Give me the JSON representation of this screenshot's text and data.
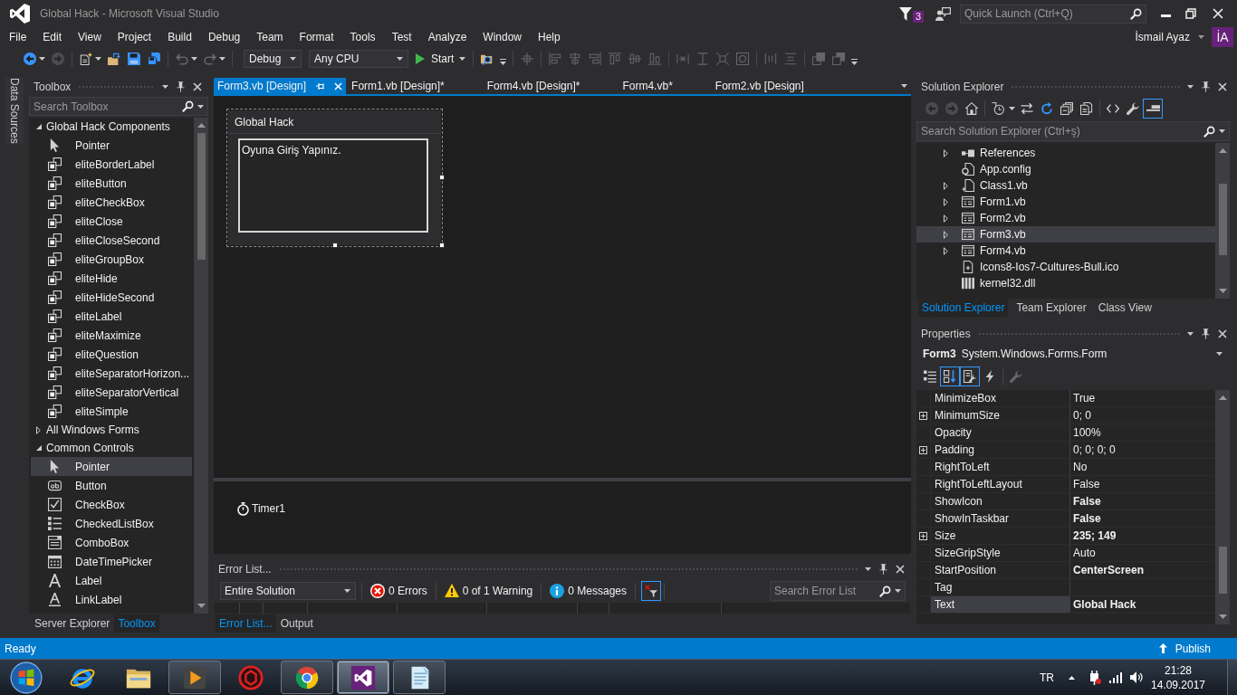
{
  "window": {
    "title": "Global Hack - Microsoft Visual Studio",
    "notification_count": "3",
    "quick_launch": {
      "placeholder": "Quick Launch (Ctrl+Q)"
    },
    "account": {
      "name": "İsmail Ayaz",
      "initials": "İA"
    }
  },
  "menu": [
    "File",
    "Edit",
    "View",
    "Project",
    "Build",
    "Debug",
    "Team",
    "Format",
    "Tools",
    "Test",
    "Analyze",
    "Window",
    "Help"
  ],
  "toolbar": {
    "groups": [
      {
        "items": [
          {
            "kind": "back",
            "disabled": false,
            "dropdown": true
          },
          {
            "kind": "forward",
            "disabled": true,
            "dropdown": false
          }
        ]
      },
      {
        "items": [
          {
            "kind": "new-project",
            "disabled": false,
            "dropdown": true
          },
          {
            "kind": "open",
            "disabled": false,
            "dropdown": false
          },
          {
            "kind": "save",
            "disabled": false,
            "dropdown": false
          },
          {
            "kind": "save-all",
            "disabled": false,
            "dropdown": false
          }
        ]
      },
      {
        "items": [
          {
            "kind": "undo",
            "disabled": true,
            "dropdown": true
          },
          {
            "kind": "redo",
            "disabled": true,
            "dropdown": true
          }
        ]
      },
      {
        "items": [
          {
            "kind": "configuration",
            "value": "Debug"
          },
          {
            "kind": "platform",
            "value": "Any CPU"
          },
          {
            "kind": "start",
            "label": "Start",
            "dropdown": true
          }
        ]
      },
      {
        "items": [
          {
            "kind": "find",
            "disabled": false,
            "dropdown": false
          },
          {
            "kind": "overflow"
          }
        ]
      },
      {
        "items": [
          {
            "kind": "align-grid",
            "disabled": true,
            "dropdown": false
          }
        ]
      },
      {
        "items": [
          {
            "kind": "align-left",
            "disabled": true,
            "dropdown": false
          },
          {
            "kind": "align-center",
            "disabled": true,
            "dropdown": false
          },
          {
            "kind": "align-right",
            "disabled": true,
            "dropdown": false
          },
          {
            "kind": "align-top",
            "disabled": true,
            "dropdown": false
          },
          {
            "kind": "align-middle",
            "disabled": true,
            "dropdown": false
          },
          {
            "kind": "align-bottom",
            "disabled": true,
            "dropdown": false
          }
        ]
      },
      {
        "items": [
          {
            "kind": "same-width",
            "disabled": true,
            "dropdown": false
          },
          {
            "kind": "same-height",
            "disabled": true,
            "dropdown": false
          },
          {
            "kind": "same-size",
            "disabled": true,
            "dropdown": false
          },
          {
            "kind": "size-grid",
            "disabled": true,
            "dropdown": false
          }
        ]
      },
      {
        "items": [
          {
            "kind": "horizontal-spacing",
            "disabled": true,
            "dropdown": false
          },
          {
            "kind": "vertical-spacing",
            "disabled": true,
            "dropdown": false
          }
        ]
      },
      {
        "items": [
          {
            "kind": "bring-front",
            "disabled": true,
            "dropdown": false
          },
          {
            "kind": "send-back",
            "disabled": true,
            "dropdown": false
          },
          {
            "kind": "overflow"
          }
        ]
      }
    ]
  },
  "side_tabs": [
    {
      "label": "Data Sources"
    }
  ],
  "toolbox": {
    "title": "Toolbox",
    "search": {
      "placeholder": "Search Toolbox"
    },
    "groups": [
      {
        "label": "Global Hack Components",
        "expanded": true,
        "children": [
          {
            "label": "Pointer",
            "kind": "pointer",
            "selected": false
          },
          {
            "label": "eliteBorderLabel",
            "kind": "component",
            "selected": false
          },
          {
            "label": "eliteButton",
            "kind": "component",
            "selected": false
          },
          {
            "label": "eliteCheckBox",
            "kind": "component",
            "selected": false
          },
          {
            "label": "eliteClose",
            "kind": "component",
            "selected": false
          },
          {
            "label": "eliteCloseSecond",
            "kind": "component",
            "selected": false
          },
          {
            "label": "eliteGroupBox",
            "kind": "component",
            "selected": false
          },
          {
            "label": "eliteHide",
            "kind": "component",
            "selected": false
          },
          {
            "label": "eliteHideSecond",
            "kind": "component",
            "selected": false
          },
          {
            "label": "eliteLabel",
            "kind": "component",
            "selected": false
          },
          {
            "label": "eliteMaximize",
            "kind": "component",
            "selected": false
          },
          {
            "label": "eliteQuestion",
            "kind": "component",
            "selected": false
          },
          {
            "label": "eliteSeparatorHorizon...",
            "kind": "component",
            "selected": false
          },
          {
            "label": "eliteSeparatorVertical",
            "kind": "component",
            "selected": false
          },
          {
            "label": "eliteSimple",
            "kind": "component",
            "selected": false
          }
        ]
      },
      {
        "label": "All Windows Forms",
        "expanded": false
      },
      {
        "label": "Common Controls",
        "expanded": true,
        "children": [
          {
            "label": "Pointer",
            "kind": "pointer",
            "selected": true
          },
          {
            "label": "Button",
            "kind": "button",
            "selected": false
          },
          {
            "label": "CheckBox",
            "kind": "checkbox",
            "selected": false
          },
          {
            "label": "CheckedListBox",
            "kind": "checked-list",
            "selected": false
          },
          {
            "label": "ComboBox",
            "kind": "combobox",
            "selected": false
          },
          {
            "label": "DateTimePicker",
            "kind": "date-picker",
            "selected": false
          },
          {
            "label": "Label",
            "kind": "label",
            "selected": false
          },
          {
            "label": "LinkLabel",
            "kind": "link-label",
            "selected": false
          }
        ]
      }
    ],
    "tabs": [
      {
        "label": "Server Explorer",
        "selected": false
      },
      {
        "label": "Toolbox",
        "selected": true
      }
    ]
  },
  "editor": {
    "tabs": [
      {
        "label": "Form3.vb [Design]",
        "selected": true
      },
      {
        "label": "Form1.vb [Design]*",
        "selected": false
      },
      {
        "label": "Form4.vb [Design]*",
        "selected": false
      },
      {
        "label": "Form4.vb*",
        "selected": false
      },
      {
        "label": "Form2.vb [Design]",
        "selected": false
      }
    ],
    "designer": {
      "form": {
        "title": "Global Hack",
        "text_box": "Oyuna Giriş Yapınız.",
        "selected": true
      }
    },
    "component_tray": [
      {
        "label": "Timer1"
      }
    ]
  },
  "error_list": {
    "title": "Error List...",
    "scope": "Entire Solution",
    "filters": [
      {
        "kind": "errors",
        "label": "0 Errors"
      },
      {
        "kind": "warnings",
        "label": "0 of 1 Warning"
      },
      {
        "kind": "messages",
        "label": "0 Messages"
      }
    ],
    "build_filter": {
      "selected": true
    },
    "search": {
      "placeholder": "Search Error List"
    },
    "tabs": [
      {
        "label": "Error List...",
        "selected": true
      },
      {
        "label": "Output",
        "selected": false
      }
    ]
  },
  "solution_explorer": {
    "title": "Solution Explorer",
    "toolbar": {
      "groups": [
        {
          "items": [
            {
              "kind": "back",
              "disabled": true,
              "selected": false,
              "dropdown": false
            },
            {
              "kind": "forward",
              "disabled": true,
              "selected": false,
              "dropdown": false
            },
            {
              "kind": "home",
              "disabled": false,
              "selected": false,
              "dropdown": false
            }
          ]
        },
        {
          "items": [
            {
              "kind": "history",
              "disabled": false,
              "selected": false,
              "dropdown": true
            },
            {
              "kind": "sync",
              "disabled": false,
              "selected": false,
              "dropdown": false
            },
            {
              "kind": "refresh",
              "disabled": false,
              "selected": false,
              "dropdown": false
            },
            {
              "kind": "collapse",
              "disabled": false,
              "selected": false,
              "dropdown": false
            },
            {
              "kind": "show-all",
              "disabled": false,
              "selected": false,
              "dropdown": false
            }
          ]
        },
        {
          "items": [
            {
              "kind": "code",
              "disabled": false,
              "selected": false,
              "dropdown": false
            },
            {
              "kind": "properties",
              "disabled": false,
              "selected": false,
              "dropdown": false
            },
            {
              "kind": "preview",
              "disabled": false,
              "selected": true,
              "dropdown": false
            }
          ]
        }
      ]
    },
    "search": {
      "placeholder": "Search Solution Explorer (Ctrl+ş)"
    },
    "items": [
      {
        "label": "References",
        "kind": "references",
        "expandable": true,
        "selected": false
      },
      {
        "label": "App.config",
        "kind": "config",
        "expandable": false,
        "selected": false
      },
      {
        "label": "Class1.vb",
        "kind": "code-file",
        "expandable": true,
        "selected": false
      },
      {
        "label": "Form1.vb",
        "kind": "form",
        "expandable": true,
        "selected": false
      },
      {
        "label": "Form2.vb",
        "kind": "form",
        "expandable": true,
        "selected": false
      },
      {
        "label": "Form3.vb",
        "kind": "form",
        "expandable": true,
        "selected": true
      },
      {
        "label": "Form4.vb",
        "kind": "form",
        "expandable": true,
        "selected": false
      },
      {
        "label": "Icons8-Ios7-Cultures-Bull.ico",
        "kind": "icon-file",
        "expandable": false,
        "selected": false
      },
      {
        "label": "kernel32.dll",
        "kind": "library",
        "expandable": false,
        "selected": false
      }
    ],
    "tabs": [
      {
        "label": "Solution Explorer",
        "selected": true
      },
      {
        "label": "Team Explorer",
        "selected": false
      },
      {
        "label": "Class View",
        "selected": false
      }
    ]
  },
  "properties": {
    "title": "Properties",
    "object_name": "Form3",
    "object_type": "System.Windows.Forms.Form",
    "toolbar": {
      "groups": [
        {
          "items": [
            {
              "kind": "categorized",
              "disabled": false,
              "selected": false
            },
            {
              "kind": "alphabetical",
              "disabled": false,
              "selected": true
            },
            {
              "kind": "property-list",
              "disabled": false,
              "selected": true
            },
            {
              "kind": "events",
              "disabled": false,
              "selected": false
            }
          ]
        },
        {
          "items": [
            {
              "kind": "property-pages",
              "disabled": true,
              "selected": false
            }
          ]
        }
      ]
    },
    "rows": [
      {
        "name": "MinimizeBox",
        "value": "True",
        "expandable": false,
        "modified": false,
        "selected": false
      },
      {
        "name": "MinimumSize",
        "value": "0; 0",
        "expandable": true,
        "modified": false,
        "selected": false
      },
      {
        "name": "Opacity",
        "value": "100%",
        "expandable": false,
        "modified": false,
        "selected": false
      },
      {
        "name": "Padding",
        "value": "0; 0; 0; 0",
        "expandable": true,
        "modified": false,
        "selected": false
      },
      {
        "name": "RightToLeft",
        "value": "No",
        "expandable": false,
        "modified": false,
        "selected": false
      },
      {
        "name": "RightToLeftLayout",
        "value": "False",
        "expandable": false,
        "modified": false,
        "selected": false
      },
      {
        "name": "ShowIcon",
        "value": "False",
        "expandable": false,
        "modified": true,
        "selected": false
      },
      {
        "name": "ShowInTaskbar",
        "value": "False",
        "expandable": false,
        "modified": true,
        "selected": false
      },
      {
        "name": "Size",
        "value": "235; 149",
        "expandable": true,
        "modified": true,
        "selected": false
      },
      {
        "name": "SizeGripStyle",
        "value": "Auto",
        "expandable": false,
        "modified": false,
        "selected": false
      },
      {
        "name": "StartPosition",
        "value": "CenterScreen",
        "expandable": false,
        "modified": true,
        "selected": false
      },
      {
        "name": "Tag",
        "expandable": false,
        "selected": false
      },
      {
        "name": "Text",
        "value": "Global Hack",
        "expandable": false,
        "modified": true,
        "selected": true
      }
    ]
  },
  "status_bar": {
    "text": "Ready",
    "publish": "Publish"
  },
  "taskbar": {
    "apps": [
      {
        "kind": "orbit-ring",
        "running": false,
        "selected": false
      },
      {
        "kind": "folder",
        "running": false,
        "selected": false
      },
      {
        "kind": "play",
        "running": true,
        "selected": false
      },
      {
        "kind": "round-emblem",
        "running": false,
        "selected": false
      },
      {
        "kind": "segmented-circle",
        "running": true,
        "selected": false
      },
      {
        "kind": "infinity",
        "running": true,
        "selected": true
      },
      {
        "kind": "notepad",
        "running": true,
        "selected": false
      }
    ],
    "language": "TR",
    "time": "21:28",
    "date": "14.09.2017"
  }
}
